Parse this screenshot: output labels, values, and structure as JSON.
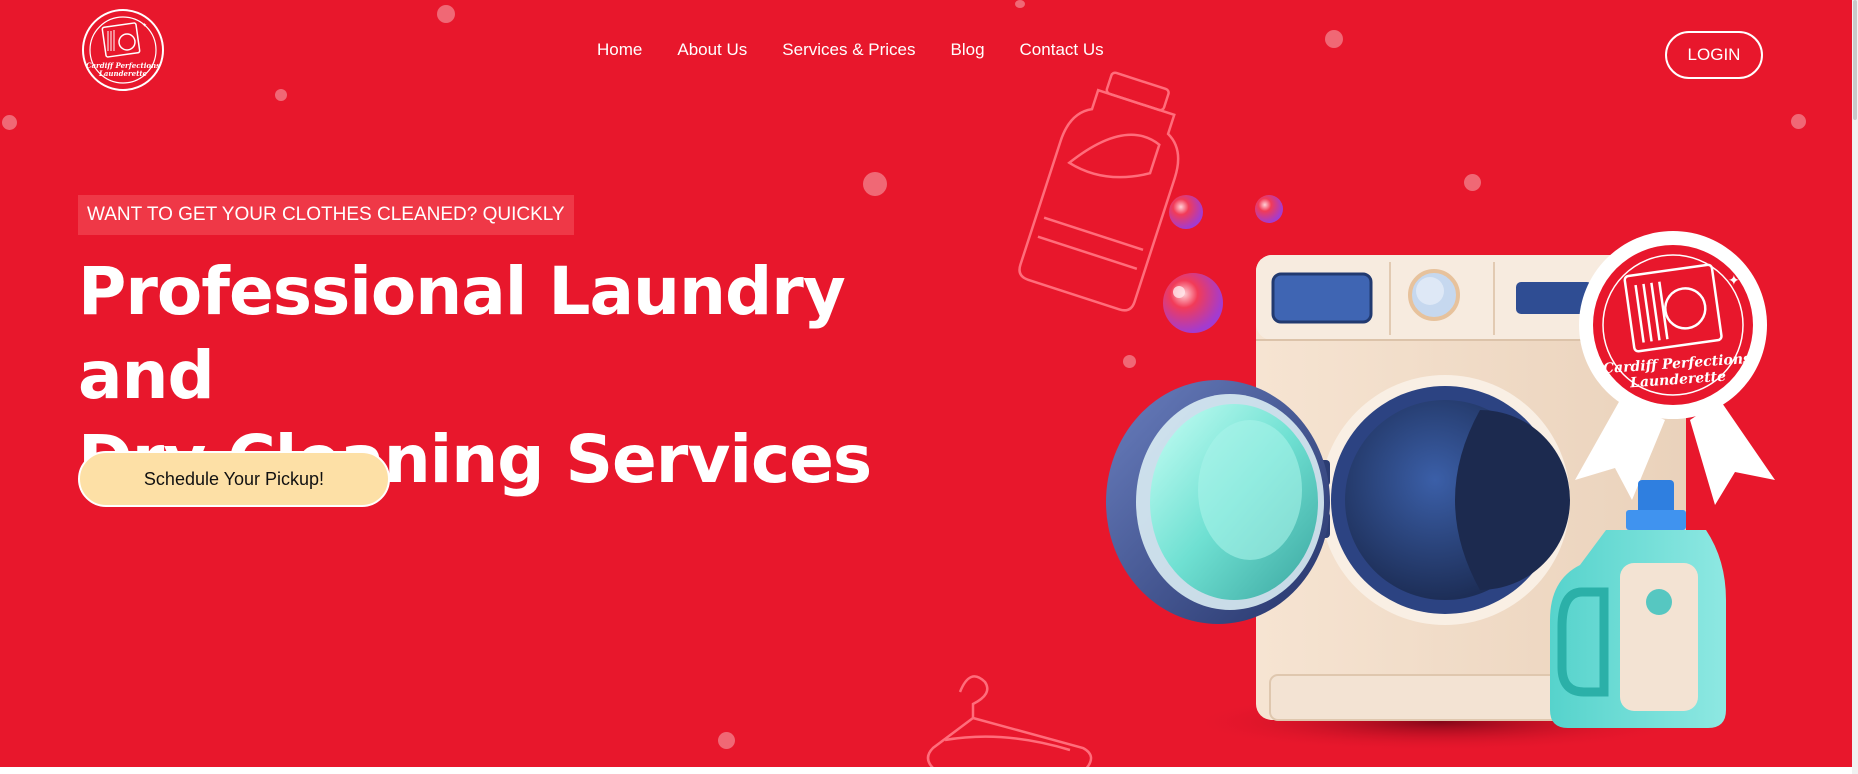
{
  "brand": {
    "logo_text_line1": "Cardiff Perfections",
    "logo_text_line2": "Launderette"
  },
  "nav": {
    "items": [
      "Home",
      "About Us",
      "Services & Prices",
      "Blog",
      "Contact Us"
    ]
  },
  "header": {
    "login_label": "LOGIN"
  },
  "hero": {
    "tagline": "WANT TO GET YOUR CLOTHES CLEANED? QUICKLY",
    "headline_line1": "Professional Laundry and",
    "headline_line2": "Dry Cleaning Services",
    "cta_label": "Schedule Your Pickup!"
  },
  "colors": {
    "primary_red": "#e8172c",
    "cta_yellow": "#fde0a6",
    "white": "#ffffff"
  },
  "icons": [
    "laundry-logo-icon",
    "detergent-bottle-outline-icon",
    "hanger-outline-icon",
    "washing-machine-illustration",
    "detergent-bottle-illustration",
    "award-badge-icon"
  ]
}
